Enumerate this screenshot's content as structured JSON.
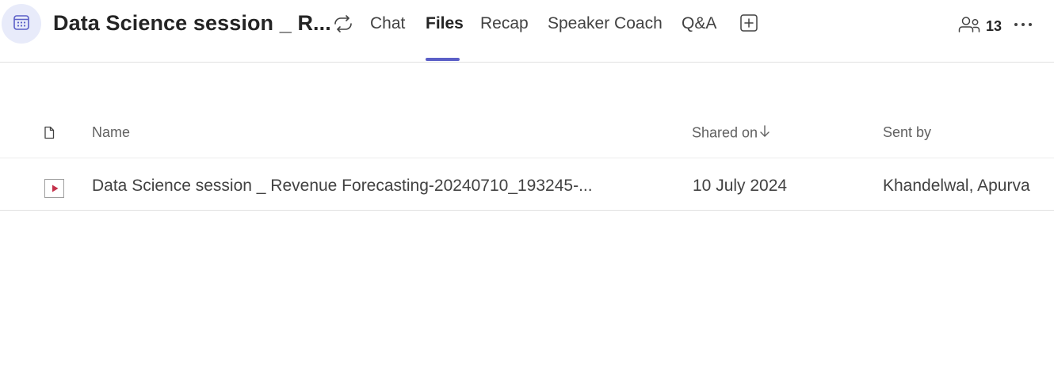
{
  "header": {
    "title": "Data Science session _ R...",
    "tabs": [
      {
        "label": "Chat",
        "active": false
      },
      {
        "label": "Files",
        "active": true
      },
      {
        "label": "Recap",
        "active": false
      },
      {
        "label": "Speaker Coach",
        "active": false
      },
      {
        "label": "Q&A",
        "active": false
      }
    ],
    "participants_count": "13",
    "icons": {
      "avatar": "calendar-icon",
      "sync": "sync-icon",
      "add_tab": "add-tab-icon",
      "participants": "people-icon",
      "more": "more-options-icon"
    }
  },
  "files": {
    "columns": {
      "name": "Name",
      "shared_on": "Shared on",
      "sent_by": "Sent by"
    },
    "sort": {
      "column": "shared_on",
      "direction": "descending"
    },
    "rows": [
      {
        "type_icon": "video-file-icon",
        "name": "Data Science session _ Revenue Forecasting-20240710_193245-...",
        "shared_on": "10 July 2024",
        "sent_by": "Khandelwal, Apurva"
      }
    ]
  },
  "colors": {
    "accent": "#5b5fc7",
    "avatar_bg": "#e8ebfa",
    "video_icon": "#c4314b"
  }
}
